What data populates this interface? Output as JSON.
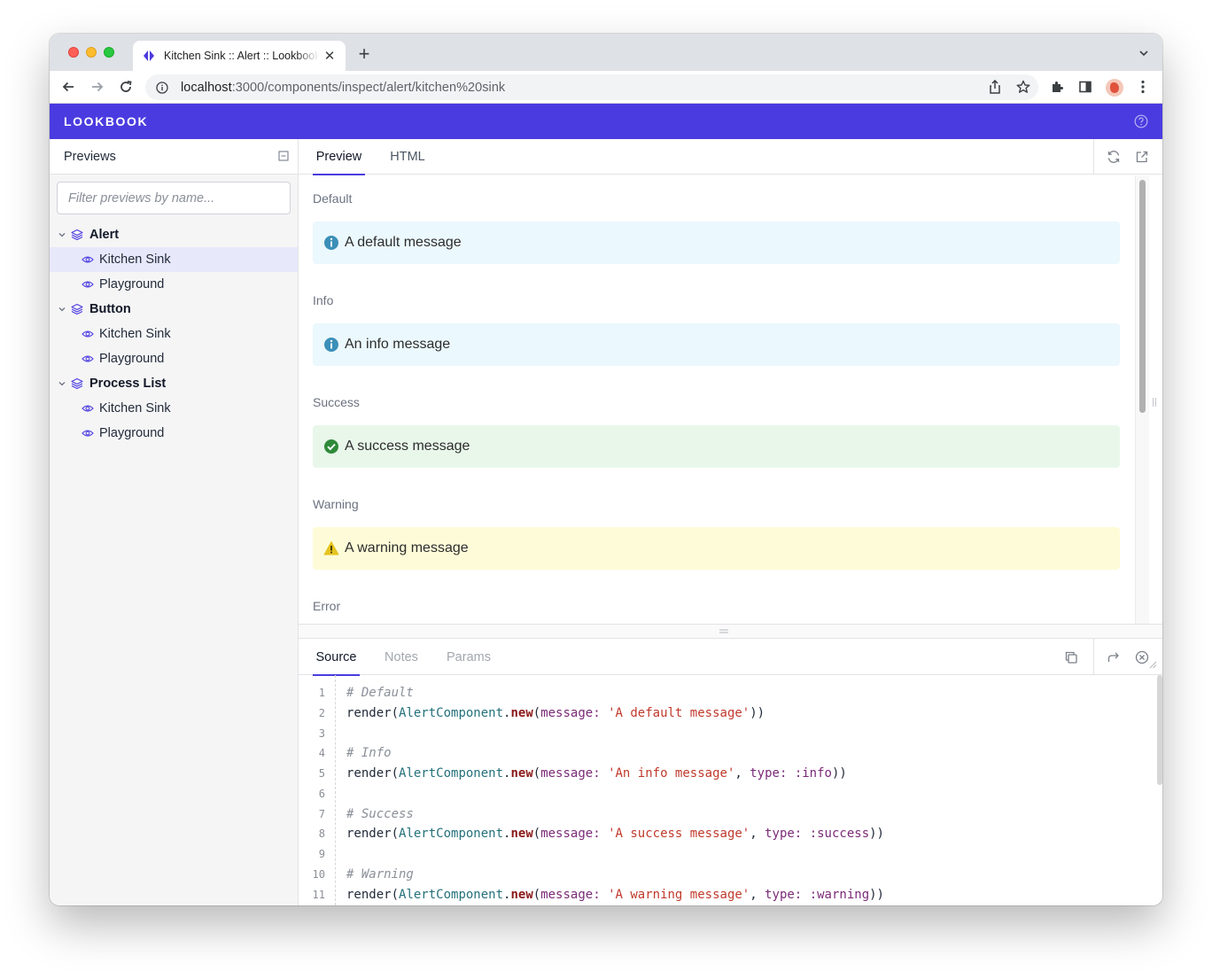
{
  "browser": {
    "tab_title": "Kitchen Sink :: Alert :: Lookbook",
    "url_host": "localhost",
    "url_rest": ":3000/components/inspect/alert/kitchen%20sink"
  },
  "app": {
    "brand": "LOOKBOOK"
  },
  "sidebar": {
    "title": "Previews",
    "filter_placeholder": "Filter previews by name...",
    "groups": [
      {
        "label": "Alert",
        "items": [
          {
            "label": "Kitchen Sink"
          },
          {
            "label": "Playground"
          }
        ]
      },
      {
        "label": "Button",
        "items": [
          {
            "label": "Kitchen Sink"
          },
          {
            "label": "Playground"
          }
        ]
      },
      {
        "label": "Process List",
        "items": [
          {
            "label": "Kitchen Sink"
          },
          {
            "label": "Playground"
          }
        ]
      }
    ]
  },
  "preview": {
    "tabs": [
      {
        "label": "Preview"
      },
      {
        "label": "HTML"
      }
    ],
    "sections": [
      {
        "label": "Default",
        "message": "A default message",
        "bg": "#ebf8fd",
        "icon_color": "#3b8fb8"
      },
      {
        "label": "Info",
        "message": "An info message",
        "bg": "#ebf8fd",
        "icon_color": "#3b8fb8"
      },
      {
        "label": "Success",
        "message": "A success message",
        "bg": "#e8f7ea",
        "icon_color": "#2f8a3a"
      },
      {
        "label": "Warning",
        "message": "A warning message",
        "bg": "#fefcd8",
        "icon_color": "#e6c420"
      },
      {
        "label": "Error"
      }
    ]
  },
  "inspector": {
    "tabs": [
      {
        "label": "Source"
      },
      {
        "label": "Notes"
      },
      {
        "label": "Params"
      }
    ],
    "code": {
      "line_numbers": [
        "1",
        "2",
        "3",
        "4",
        "5",
        "6",
        "7",
        "8",
        "9",
        "10",
        "11"
      ],
      "comments": [
        "# Default",
        "# Info",
        "# Success",
        "# Warning"
      ],
      "render": "render(",
      "const": "AlertComponent",
      "dot": ".",
      "method": "new",
      "open": "(",
      "message_key": "message:",
      "type_key": "type:",
      "comma": ", ",
      "close_one": "))",
      "strings": [
        "'A default message'",
        "'An info message'",
        "'A success message'",
        "'A warning message'"
      ],
      "symbols": [
        ":info",
        ":success",
        ":warning"
      ]
    }
  },
  "colors": {
    "accent": "#4a3be0"
  }
}
